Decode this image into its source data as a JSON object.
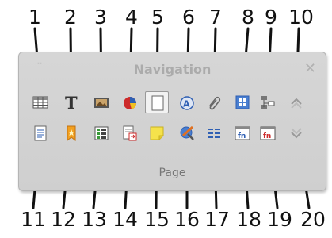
{
  "callouts": {
    "top": [
      "1",
      "2",
      "3",
      "4",
      "5",
      "6",
      "7",
      "8",
      "9",
      "10"
    ],
    "bottom": [
      "11",
      "12",
      "13",
      "14",
      "15",
      "16",
      "17",
      "18",
      "19",
      "20"
    ]
  },
  "panel": {
    "title": "Navigation",
    "footer": "Page"
  },
  "icons": {
    "row1": [
      "table-icon",
      "text-icon",
      "image-icon",
      "object-icon",
      "page-icon",
      "drawing-icon",
      "clip-icon",
      "control-icon",
      "hierarchy-icon",
      "up-arrow-icon"
    ],
    "row2": [
      "document-icon",
      "bookmark-icon",
      "list-icon",
      "insert-icon",
      "note-icon",
      "compass-icon",
      "columns-icon",
      "function-field-icon",
      "function-field-red-icon",
      "down-arrow-icon"
    ]
  },
  "colors": {
    "panel_bg": "#d3d3d3",
    "accent_blue": "#2f5fb3",
    "accent_red": "#cc2a2a",
    "note_yellow": "#f5e24b"
  }
}
